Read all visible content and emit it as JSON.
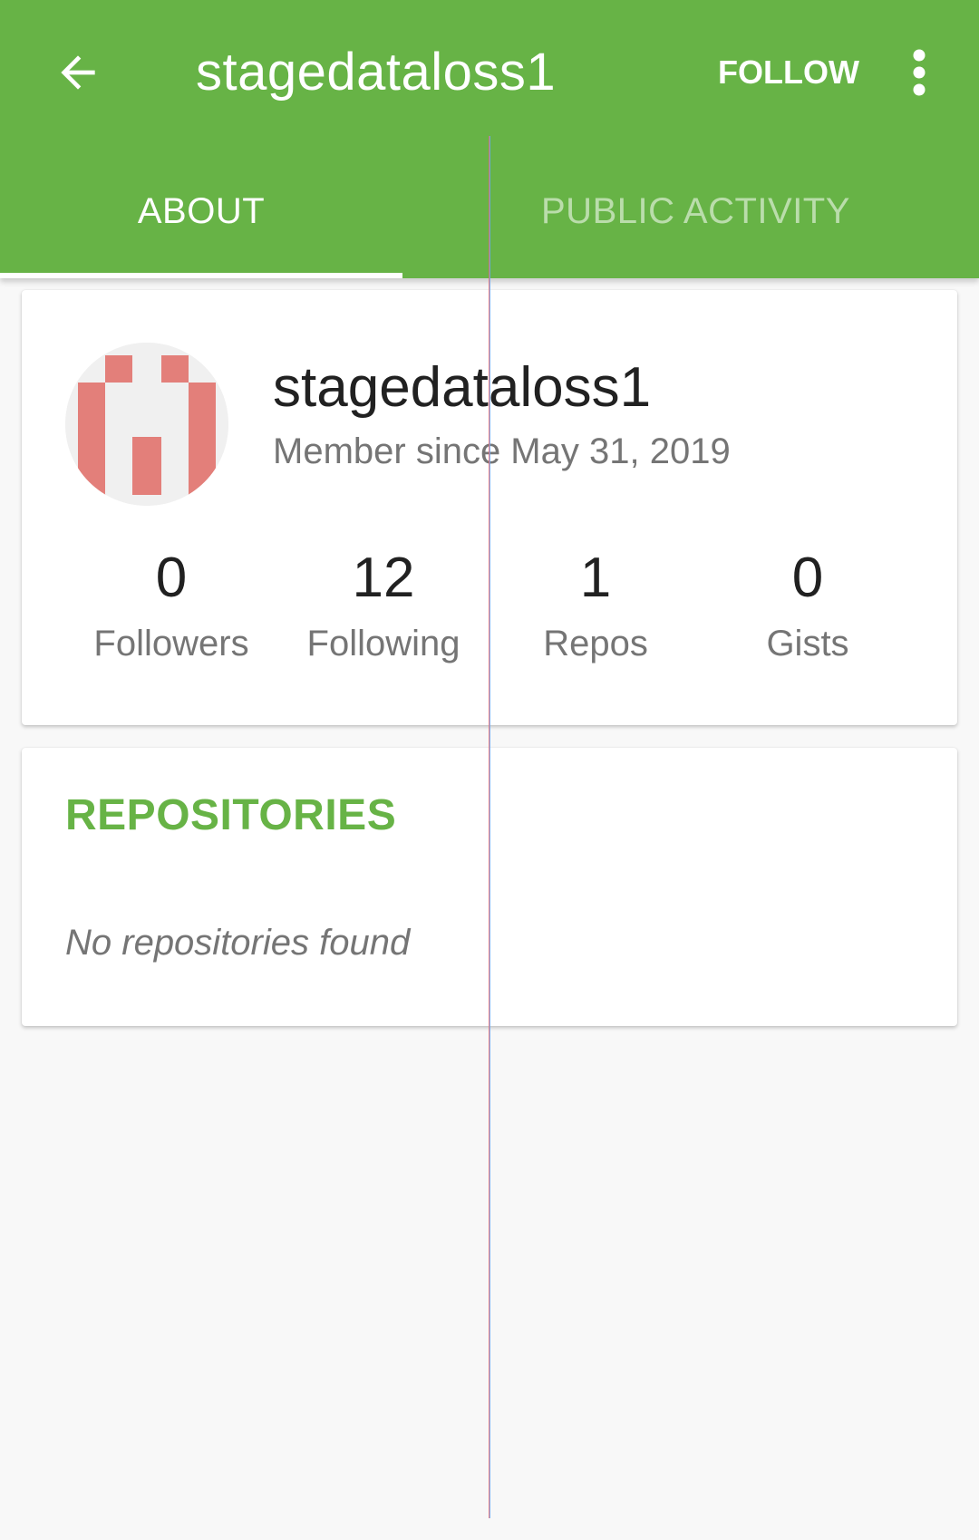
{
  "toolbar": {
    "title": "stagedataloss1",
    "follow_label": "FOLLOW"
  },
  "tabs": [
    {
      "label": "ABOUT",
      "selected": true
    },
    {
      "label": "PUBLIC ACTIVITY",
      "selected": false
    }
  ],
  "profile": {
    "name": "stagedataloss1",
    "member_since": "Member since May 31, 2019",
    "stats": [
      {
        "count": "0",
        "label": "Followers"
      },
      {
        "count": "12",
        "label": "Following"
      },
      {
        "count": "1",
        "label": "Repos"
      },
      {
        "count": "0",
        "label": "Gists"
      }
    ]
  },
  "repositories": {
    "title": "REPOSITORIES",
    "empty_message": "No repositories found"
  },
  "colors": {
    "primary": "#67b346",
    "avatar_accent": "#e37f7a",
    "background": "#f8f8f8"
  },
  "icons": {
    "back": "arrow-back-icon",
    "overflow": "more-vert-icon"
  }
}
